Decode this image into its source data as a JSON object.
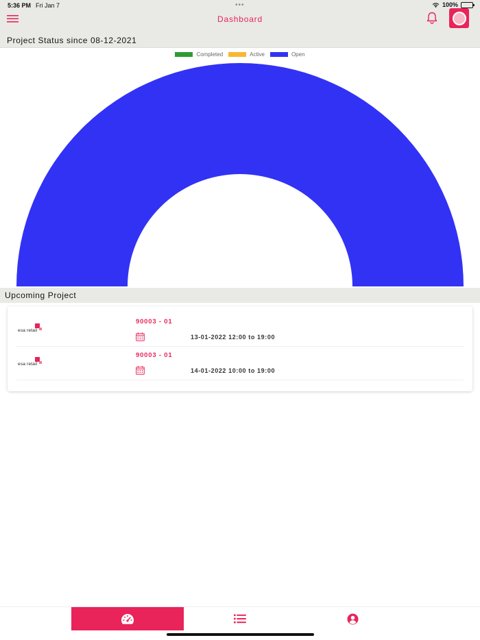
{
  "status_bar": {
    "time": "5:36 PM",
    "date": "Fri Jan 7",
    "battery": "100%"
  },
  "header": {
    "title": "Dashboard"
  },
  "status_section": {
    "title": "Project Status since 08-12-2021"
  },
  "chart_data": {
    "type": "pie",
    "variant": "half-doughnut",
    "legend_position": "top",
    "series": [
      {
        "name": "Completed",
        "value": 0,
        "color": "#2e9c33"
      },
      {
        "name": "Active",
        "value": 0,
        "color": "#f7b731"
      },
      {
        "name": "Open",
        "value": 2,
        "color": "#3232f5"
      }
    ]
  },
  "upcoming_section": {
    "title": "Upcoming Project"
  },
  "projects": [
    {
      "logo_text": "esa retail",
      "id": "90003 - 01",
      "time": "13-01-2022 12:00 to 19:00"
    },
    {
      "logo_text": "esa retail",
      "id": "90003 - 01",
      "time": "14-01-2022 10:00 to 19:00"
    }
  ],
  "colors": {
    "accent": "#e8245a",
    "header_bg": "#e9eae5"
  },
  "tabs": [
    {
      "icon": "dashboard-icon",
      "active": true
    },
    {
      "icon": "list-icon",
      "active": false
    },
    {
      "icon": "user-icon",
      "active": false
    }
  ]
}
